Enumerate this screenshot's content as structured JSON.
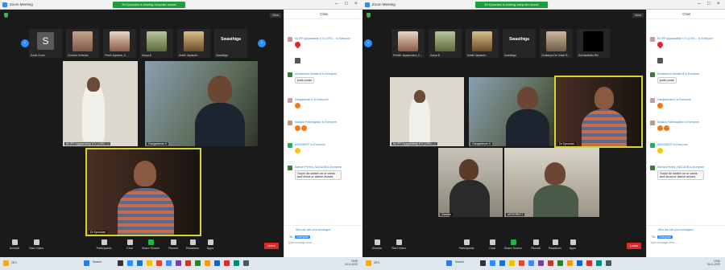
{
  "app": {
    "window_title": "Zoom Meeting",
    "screen_share_banner": "Mr Epsonian is sharing computer sound",
    "view_label": "View",
    "chat_title": "Chat"
  },
  "left": {
    "strip": [
      {
        "name": "Sumit Zorvin",
        "initial": "S"
      },
      {
        "name": "Chetoon Helenika"
      },
      {
        "name": "Preeti Jayasree_K..."
      },
      {
        "name": "Kavya B"
      },
      {
        "name": "Keethi Jayasuth..."
      },
      {
        "name": "Swasthiga",
        "big": "Swasthiga"
      }
    ],
    "tiles": [
      {
        "name": "Mr IPP Appyandeep K K (J.RIC...)"
      },
      {
        "name": "Gangadevan K"
      },
      {
        "name": "Dr Epsonian"
      }
    ]
  },
  "right": {
    "strip": [
      {
        "name": "Preethi Jayasundera_K..."
      },
      {
        "name": "Kavya B"
      },
      {
        "name": "Keethi Jayasuth..."
      },
      {
        "name": "Swasthiga",
        "big": "Swasthiga"
      },
      {
        "name": "Chaitanya Dei Sirkar R..."
      },
      {
        "name": "Sai Nandhika RM"
      }
    ],
    "tiles": [
      {
        "name": "Mr IPP Appyandeep K K (J.RIC...)"
      },
      {
        "name": "Gangadevan K"
      },
      {
        "name": "Dr Epsonian"
      },
      {
        "name": "Ganesh"
      },
      {
        "name": "MOHORIOT"
      }
    ]
  },
  "chat": {
    "messages": [
      {
        "from": "Mr IPP Appyandeep K K (J.RIC... to Everyone",
        "body": ""
      },
      {
        "from": "",
        "body": ""
      },
      {
        "from": "Mohammed Suhaib M to Everyone",
        "body": "podu podu"
      },
      {
        "from": "Gangadevan K to Everyone",
        "body": ""
      },
      {
        "from": "Masana Pathmayalan to Everyone",
        "body": ""
      },
      {
        "from": "MOHORIOT to Everyone",
        "body": ""
      },
      {
        "from": "Samuel Perera_NACUGN to Everyone",
        "body": "Guys! do switch on ur cams and show ur dance moves"
      }
    ],
    "who_can_see": "Who can see your messages?",
    "to_label": "To:",
    "to_value": "Everyone",
    "input_placeholder": "Type message here..."
  },
  "controls": {
    "unmute": "Unmute",
    "start_video": "Start Video",
    "participants": "Participants",
    "participants_count": "35",
    "chat": "Chat",
    "share_screen": "Share Screen",
    "record": "Record",
    "reactions": "Reactions",
    "apps": "Apps",
    "leave": "Leave"
  },
  "taskbar": {
    "weather": "28°C",
    "search": "Search",
    "time": "10:50",
    "date": "04-11-2022"
  },
  "colors": {
    "zoom_blue": "#2d8cff",
    "active_speaker": "#d4d42b",
    "leave_red": "#e02828",
    "share_green": "#22b24c"
  }
}
